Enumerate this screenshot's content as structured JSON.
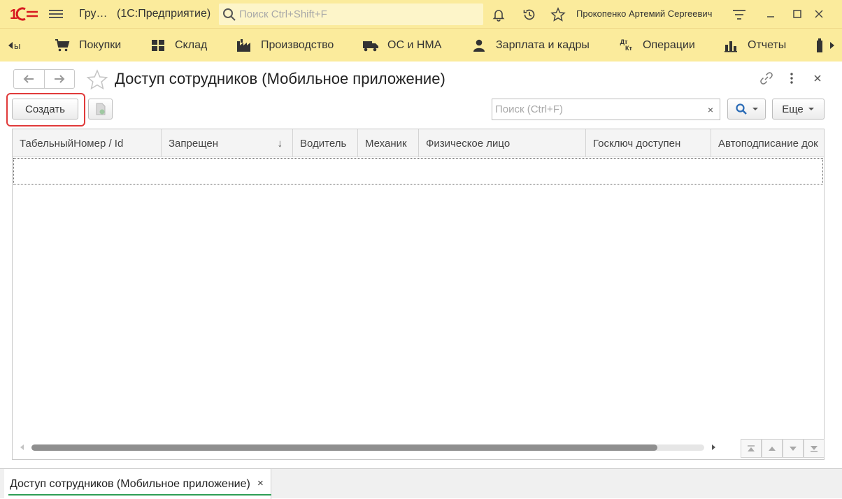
{
  "titlebar": {
    "app_short": "Гру…",
    "app_name": "(1С:Предприятие)",
    "search_placeholder": "Поиск Ctrl+Shift+F",
    "user_name": "Прокопенко Артемий Сергеевич"
  },
  "sections": {
    "items": [
      {
        "label": "ы",
        "icon": "partial-icon"
      },
      {
        "label": "Покупки",
        "icon": "cart-icon"
      },
      {
        "label": "Склад",
        "icon": "warehouse-icon"
      },
      {
        "label": "Производство",
        "icon": "factory-icon"
      },
      {
        "label": "ОС и НМА",
        "icon": "truck-icon"
      },
      {
        "label": "Зарплата и кадры",
        "icon": "person-icon"
      },
      {
        "label": "Операции",
        "icon": "debit-credit-icon"
      },
      {
        "label": "Отчеты",
        "icon": "bar-chart-icon"
      }
    ],
    "dtkt_top": "Дт",
    "dtkt_bottom": "Кт"
  },
  "form": {
    "title": "Доступ сотрудников (Мобильное приложение)",
    "create_label": "Создать",
    "filter_placeholder": "Поиск (Ctrl+F)",
    "clear_label": "×",
    "more_label": "Еще"
  },
  "table": {
    "columns": [
      {
        "label": "ТабельныйНомер / Id"
      },
      {
        "label": "Запрещен"
      },
      {
        "label": "Водитель"
      },
      {
        "label": "Механик"
      },
      {
        "label": "Физическое лицо"
      },
      {
        "label": "Госключ доступен"
      },
      {
        "label": "Автоподписание док"
      }
    ],
    "sort_indicator": "↓"
  },
  "bottom": {
    "open_tab_label": "Доступ сотрудников (Мобильное приложение)",
    "open_tab_close": "×"
  },
  "colors": {
    "accent_yellow": "#fbeb9c",
    "highlight_red": "#e03a3a",
    "tab_underline": "#2e9e55",
    "logo_red": "#d71920"
  }
}
